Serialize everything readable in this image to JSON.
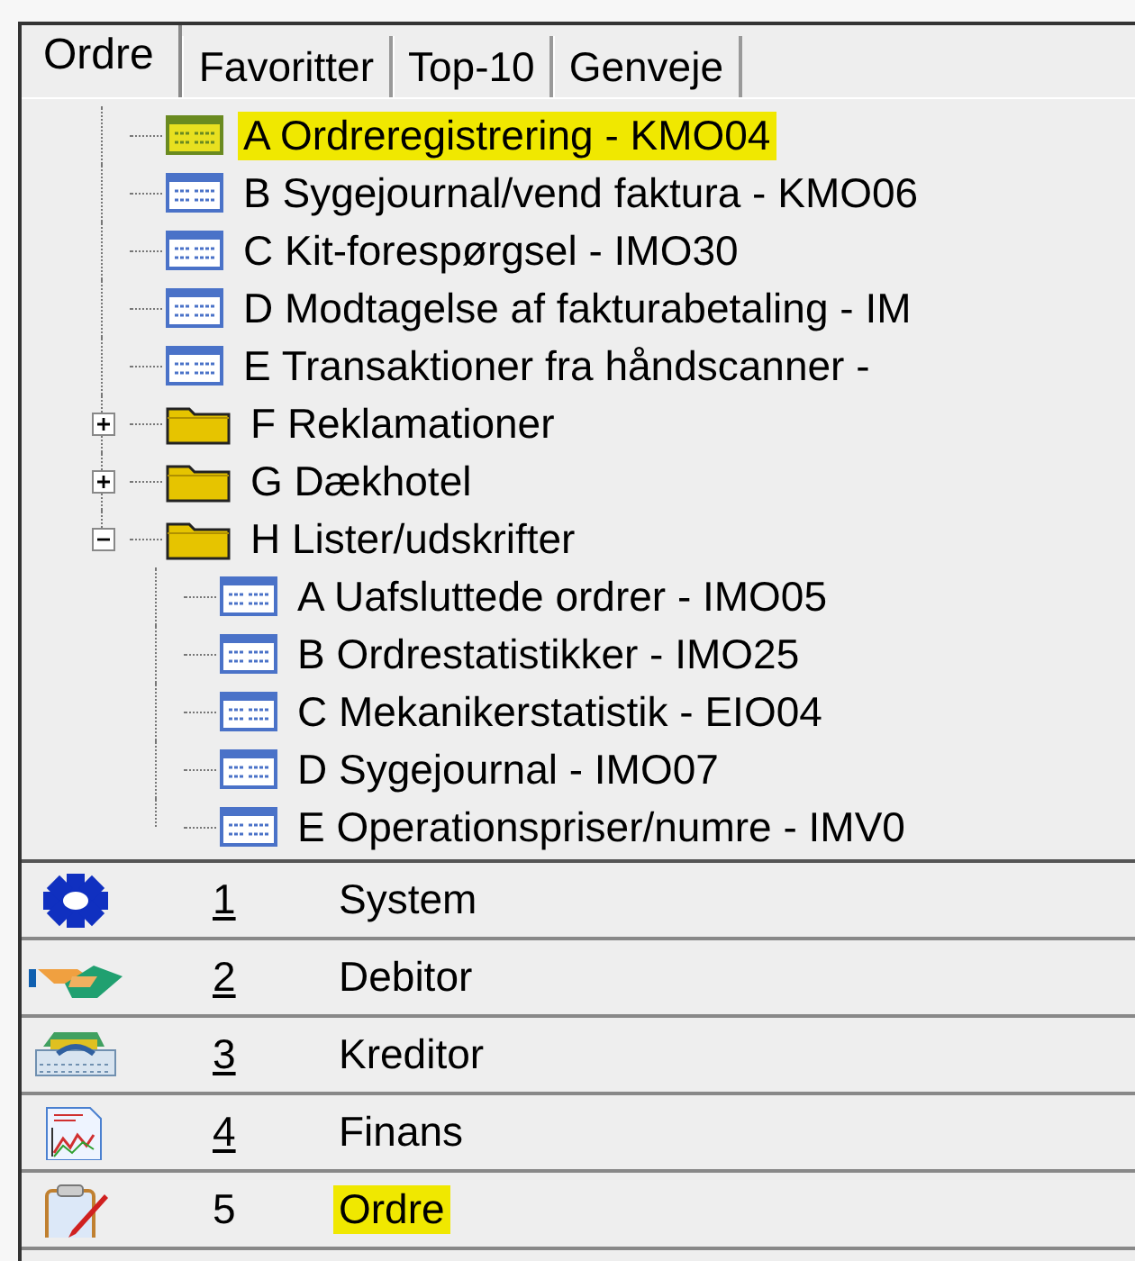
{
  "tabs": [
    {
      "label": "Ordre",
      "selected": true
    },
    {
      "label": "Favoritter",
      "selected": false
    },
    {
      "label": "Top-10",
      "selected": false
    },
    {
      "label": "Genveje",
      "selected": false
    }
  ],
  "tree": [
    {
      "kind": "doc",
      "label": "A Ordreregistrering - KMO04",
      "selected": true
    },
    {
      "kind": "doc",
      "label": "B Sygejournal/vend faktura - KMO06",
      "selected": false
    },
    {
      "kind": "doc",
      "label": "C Kit-forespørgsel - IMO30",
      "selected": false
    },
    {
      "kind": "doc",
      "label": "D Modtagelse af fakturabetaling - IM",
      "selected": false
    },
    {
      "kind": "doc",
      "label": "E Transaktioner fra håndscanner -",
      "selected": false
    },
    {
      "kind": "folder",
      "label": "F Reklamationer",
      "selected": false,
      "expanded": false
    },
    {
      "kind": "folder",
      "label": "G Dækhotel",
      "selected": false,
      "expanded": false
    },
    {
      "kind": "folder",
      "label": "H Lister/udskrifter",
      "selected": false,
      "expanded": true,
      "children": [
        {
          "kind": "doc",
          "label": "A Uafsluttede ordrer - IMO05",
          "selected": false
        },
        {
          "kind": "doc",
          "label": "B Ordrestatistikker - IMO25",
          "selected": false
        },
        {
          "kind": "doc",
          "label": "C Mekanikerstatistik - EIO04",
          "selected": false
        },
        {
          "kind": "doc",
          "label": "D Sygejournal - IMO07",
          "selected": false
        },
        {
          "kind": "doc",
          "label": "E Operationspriser/numre - IMV0",
          "selected": false
        }
      ]
    }
  ],
  "nav": [
    {
      "kind": "system",
      "number": "1",
      "label": "System",
      "selected": false
    },
    {
      "kind": "debitor",
      "number": "2",
      "label": "Debitor",
      "selected": false
    },
    {
      "kind": "kreditor",
      "number": "3",
      "label": "Kreditor",
      "selected": false
    },
    {
      "kind": "finans",
      "number": "4",
      "label": "Finans",
      "selected": false
    },
    {
      "kind": "ordre",
      "number": "5",
      "label": "Ordre",
      "selected": true
    }
  ]
}
